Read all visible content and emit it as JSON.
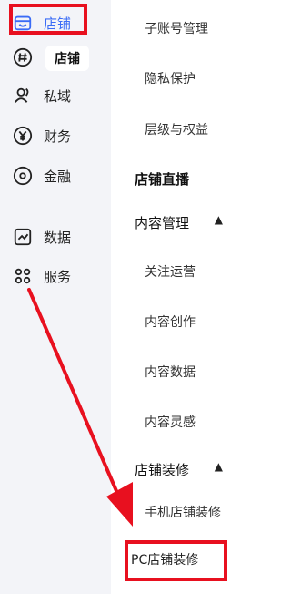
{
  "rail": {
    "items": [
      {
        "label": "店铺",
        "icon": "store-icon",
        "active": true
      },
      {
        "label": "私域",
        "icon": "users-icon"
      },
      {
        "label": "财务",
        "icon": "yuan-icon"
      },
      {
        "label": "金融",
        "icon": "finance-icon"
      },
      {
        "label": "数据",
        "icon": "chart-icon"
      },
      {
        "label": "服务",
        "icon": "apps-icon"
      }
    ],
    "sub_chip": {
      "label": "店铺",
      "icon": "hash-icon"
    },
    "accent": "#3b6cf6"
  },
  "menu": {
    "items": [
      {
        "label": "子账号管理"
      },
      {
        "label": "隐私保护"
      },
      {
        "label": "层级与权益"
      }
    ],
    "store_live": "店铺直播",
    "content_mgmt": {
      "label": "内容管理",
      "items": [
        "关注运营",
        "内容创作",
        "内容数据",
        "内容灵感"
      ]
    },
    "store_decor": {
      "label": "店铺装修",
      "items": [
        "手机店铺装修",
        "PC店铺装修"
      ]
    }
  },
  "annotation_color": "#e8101f"
}
